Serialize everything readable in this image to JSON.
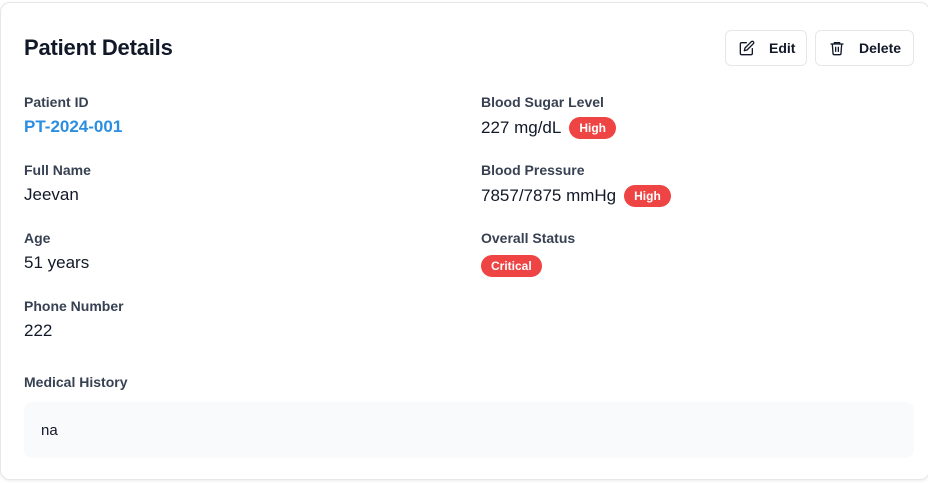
{
  "header": {
    "title": "Patient Details",
    "edit_label": "Edit",
    "delete_label": "Delete"
  },
  "fields": {
    "patient_id": {
      "label": "Patient ID",
      "value": "PT-2024-001"
    },
    "full_name": {
      "label": "Full Name",
      "value": "Jeevan"
    },
    "age": {
      "label": "Age",
      "value": "51 years"
    },
    "phone": {
      "label": "Phone Number",
      "value": "222"
    },
    "blood_sugar": {
      "label": "Blood Sugar Level",
      "value": "227 mg/dL",
      "badge": "High"
    },
    "blood_pressure": {
      "label": "Blood Pressure",
      "value": "7857/7875 mmHg",
      "badge": "High"
    },
    "overall_status": {
      "label": "Overall Status",
      "badge": "Critical"
    }
  },
  "medical_history": {
    "label": "Medical History",
    "value": "na"
  },
  "colors": {
    "accent_link": "#2b8ee0",
    "badge_danger": "#ef4444",
    "history_bg": "#f9fafb"
  },
  "icons": {
    "edit": "edit-icon",
    "delete": "trash-icon"
  }
}
